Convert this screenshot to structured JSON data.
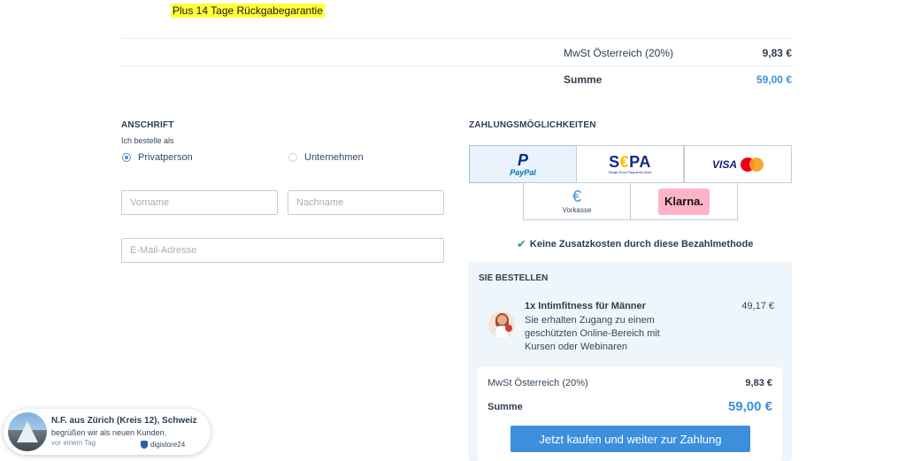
{
  "guarantee": "Plus 14 Tage Rückgabegarantie",
  "top_summary": {
    "vat_label": "MwSt Österreich (20%)",
    "vat_value": "9,83 €",
    "sum_label": "Summe",
    "sum_value": "59,00 €"
  },
  "address": {
    "title": "ANSCHRIFT",
    "order_as_label": "Ich bestelle als",
    "options": [
      "Privatperson",
      "Unternehmen"
    ],
    "first_name_placeholder": "Vorname",
    "last_name_placeholder": "Nachname",
    "email_placeholder": "E-Mail-Adresse"
  },
  "payment": {
    "title": "ZAHLUNGSMÖGLICHKEITEN",
    "paypal_mark": "P",
    "paypal_label": "PayPal",
    "sepa_label_a": "S",
    "sepa_label_e": "€",
    "sepa_label_b": "PA",
    "sepa_sub": "Single Euro Payments Area",
    "visa_label": "VISA",
    "vorkasse_symbol": "€",
    "vorkasse_label": "Vorkasse",
    "klarna_label": "Klarna.",
    "no_fee": "Keine Zusatzkosten durch diese Bezahlmethode"
  },
  "order": {
    "title": "SIE BESTELLEN",
    "product_name": "1x Intimfitness für Männer",
    "product_desc": "Sie erhalten Zugang zu einem geschützten Online-Bereich mit Kursen oder Webinaren",
    "product_price": "49,17 €",
    "vat_label": "MwSt Österreich (20%)",
    "vat_value": "9,83 €",
    "sum_label": "Summe",
    "sum_value": "59,00 €",
    "buy_button": "Jetzt kaufen und weiter zur Zahlung"
  },
  "toast": {
    "name": "N.F. aus Zürich (Kreis 12), Schweiz",
    "message": "begrüßen wir als neuen Kunden.",
    "time": "vor einem Tag",
    "brand": "digistore24"
  }
}
